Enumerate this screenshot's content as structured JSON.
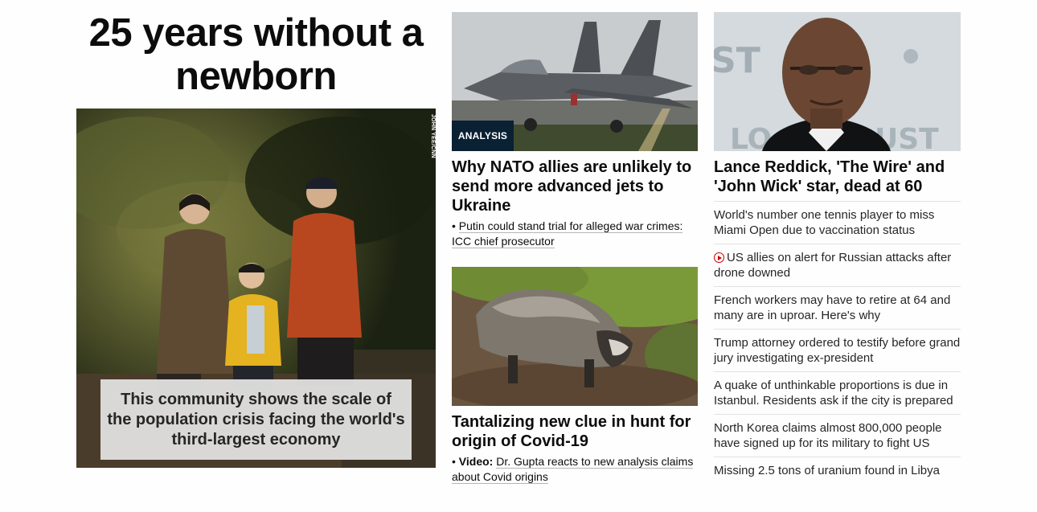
{
  "hero": {
    "headline": "25 years without a newborn",
    "photo_credit": "JOHN YEE/CNN",
    "caption": "This community shows the scale of the population crisis facing the world's third-largest economy"
  },
  "middle": {
    "story1": {
      "badge": "ANALYSIS",
      "headline": "Why NATO allies are unlikely to send more advanced jets to Ukraine",
      "related": "Putin could stand trial for alleged war crimes: ICC chief prosecutor"
    },
    "story2": {
      "headline": "Tantalizing new clue in hunt for origin of Covid-19",
      "related_prefix": "Video:",
      "related": "Dr. Gupta reacts to new analysis claims about Covid origins"
    }
  },
  "right": {
    "headline": "Lance Reddick, 'The Wire' and 'John Wick' star, dead at 60",
    "list": [
      "World's number one tennis player to miss Miami Open due to vaccination status",
      "US allies on alert for Russian attacks after drone downed",
      "French workers may have to retire at 64 and many are in uproar. Here's why",
      "Trump attorney ordered to testify before grand jury investigating ex-president",
      "A quake of unthinkable proportions is due in Istanbul. Residents ask if the city is prepared",
      "North Korea claims almost 800,000 people have signed up for its military to fight US",
      "Missing 2.5 tons of uranium found in Libya"
    ],
    "video_icon": "play-circle-icon"
  },
  "colors": {
    "badge_bg": "#0a2033",
    "video_red": "#cc0000",
    "text": "#0c0c0c"
  }
}
